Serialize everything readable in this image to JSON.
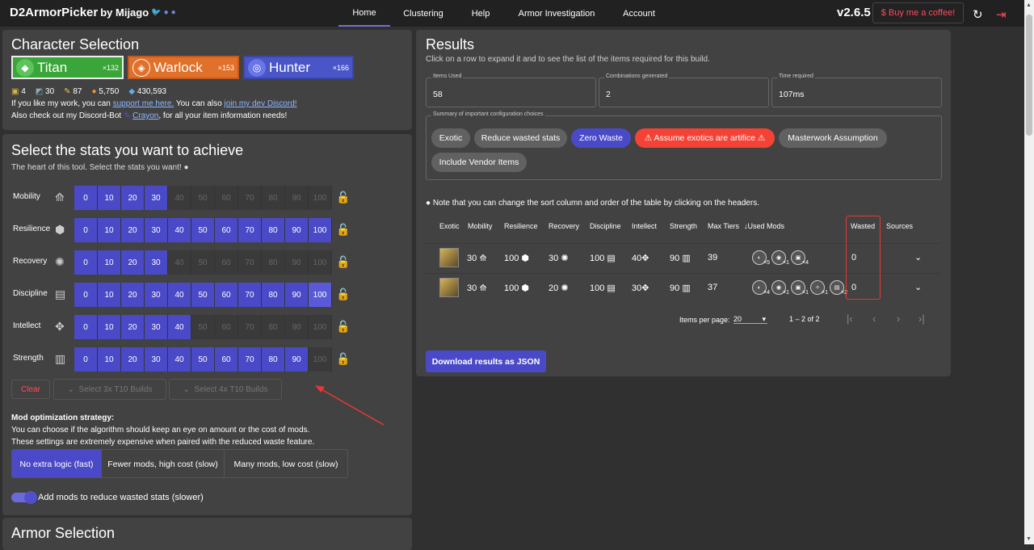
{
  "topbar": {
    "brand": "D2ArmorPicker",
    "by": "by Mijago",
    "tabs": [
      "Home",
      "Clustering",
      "Help",
      "Armor Investigation",
      "Account"
    ],
    "version": "v2.6.5",
    "coffee": "$ Buy me a coffee!"
  },
  "character": {
    "title": "Character Selection",
    "classes": [
      {
        "name": "Titan",
        "count": "×132",
        "color": "#3aa538"
      },
      {
        "name": "Warlock",
        "count": "×153",
        "color": "#e0702a"
      },
      {
        "name": "Hunter",
        "count": "×166",
        "color": "#4a56c8"
      }
    ],
    "resources": [
      "4",
      "30",
      "87",
      "5,750",
      "430,593"
    ],
    "line1_a": "If you like my work, you can ",
    "line1_link1": "support me here.",
    "line1_b": " You can also ",
    "line1_link2": "join my dev Discord!",
    "line2_a": "Also check out my Discord-Bot ",
    "line2_link": "Crayon",
    "line2_b": ", for all your item information needs!"
  },
  "stats": {
    "title": "Select the stats you want to achieve",
    "subtitle": "The heart of this tool. Select the stats you want!",
    "ticks": [
      "0",
      "10",
      "20",
      "30",
      "40",
      "50",
      "60",
      "70",
      "80",
      "90",
      "100"
    ],
    "rows": [
      {
        "label": "Mobility",
        "icon": "mobility-icon",
        "selected": 0,
        "available": 3
      },
      {
        "label": "Resilience",
        "icon": "resilience-icon",
        "selected": 0,
        "available": 10
      },
      {
        "label": "Recovery",
        "icon": "recovery-icon",
        "selected": 0,
        "available": 3
      },
      {
        "label": "Discipline",
        "icon": "discipline-icon",
        "selected": 10,
        "available": 10
      },
      {
        "label": "Intellect",
        "icon": "intellect-icon",
        "selected": 0,
        "available": 4
      },
      {
        "label": "Strength",
        "icon": "strength-icon",
        "selected": 0,
        "available": 9
      }
    ],
    "clear": "Clear",
    "t10_3": "Select 3x T10 Builds",
    "t10_4": "Select 4x T10 Builds"
  },
  "mods": {
    "title": "Mod optimization strategy:",
    "desc1": "You can choose if the algorithm should keep an eye on amount or the cost of mods.",
    "desc2": "These settings are extremely expensive when paired with the reduced waste feature.",
    "options": [
      "No extra logic (fast)",
      "Fewer mods, high cost (slow)",
      "Many mods, low cost (slow)"
    ],
    "toggle_label": "Add mods to reduce wasted stats (slower)"
  },
  "armor": {
    "title": "Armor Selection"
  },
  "results": {
    "title": "Results",
    "subtitle": "Click on a row to expand it and to see the list of the items required for this build.",
    "items_used_label": "Items Used",
    "items_used": "58",
    "combos_label": "Combinations generated",
    "combos": "2",
    "time_label": "Time required",
    "time": "107ms",
    "summary_label": "Summary of important configuration choices",
    "chips": [
      "Exotic",
      "Reduce wasted stats",
      "Zero Waste",
      "⚠ Assume exotics are artifice ⚠",
      "Masterwork Assumption",
      "Include Vendor Items"
    ],
    "note": "Note that you can change the sort column and order of the table by clicking on the headers.",
    "headers": [
      "Exotic",
      "Mobility",
      "Resilience",
      "Recovery",
      "Discipline",
      "Intellect",
      "Strength",
      "Max Tiers",
      "↓Used Mods",
      "Wasted",
      "Sources"
    ],
    "rows": [
      {
        "mob": "30",
        "res": "100",
        "rec": "30",
        "dis": "100",
        "int": "40",
        "str": "90",
        "tiers": "39",
        "wasted": "0",
        "mods": [
          "×5",
          "×1",
          "×4"
        ]
      },
      {
        "mob": "30",
        "res": "100",
        "rec": "20",
        "dis": "100",
        "int": "30",
        "str": "90",
        "tiers": "37",
        "wasted": "0",
        "mods": [
          "×4",
          "×1",
          "×1",
          "×1",
          "×2"
        ]
      }
    ],
    "per_page_label": "Items per page:",
    "per_page": "20",
    "range": "1 – 2 of 2",
    "download": "Download results as JSON"
  },
  "colors": {
    "accent": "#4a4ac8",
    "danger": "#f44336"
  }
}
